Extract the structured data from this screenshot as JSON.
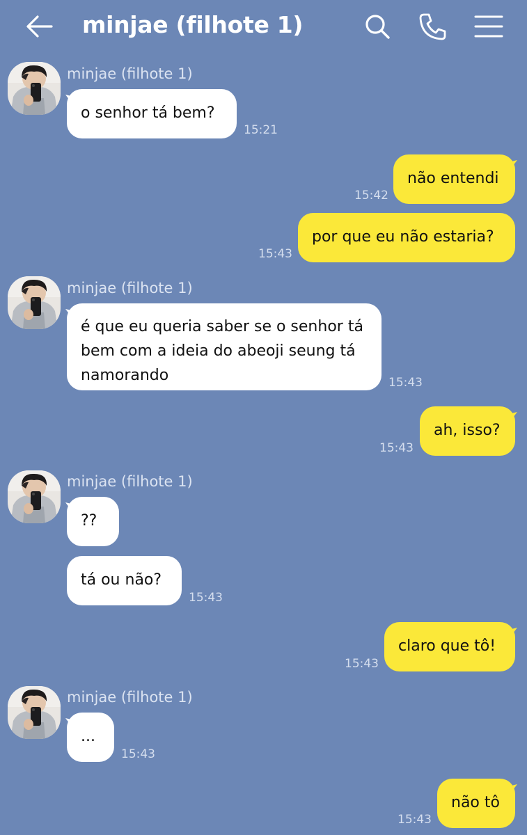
{
  "header": {
    "title": "minjae (filhote 1)",
    "back_icon": "arrow-left-icon",
    "search_icon": "search-icon",
    "call_icon": "phone-icon",
    "menu_icon": "hamburger-menu-icon"
  },
  "colors": {
    "background": "#6c87b6",
    "incoming_bubble": "#ffffff",
    "outgoing_bubble": "#fbe839"
  },
  "messages": [
    {
      "direction": "in",
      "sender": "minjae (filhote 1)",
      "text": "o senhor tá bem?",
      "time": "15:21"
    },
    {
      "direction": "out",
      "text": "não entendi",
      "time": "15:42"
    },
    {
      "direction": "out",
      "text": "por que eu não estaria?",
      "time": "15:43"
    },
    {
      "direction": "in",
      "sender": "minjae (filhote 1)",
      "text": "é que eu queria saber se o senhor tá bem com a ideia do abeoji seung tá namorando",
      "time": "15:43"
    },
    {
      "direction": "out",
      "text": "ah, isso?",
      "time": "15:43"
    },
    {
      "direction": "in",
      "sender": "minjae (filhote 1)",
      "text": "??",
      "time": ""
    },
    {
      "direction": "in",
      "text": "tá ou não?",
      "time": "15:43"
    },
    {
      "direction": "out",
      "text": "claro que tô!",
      "time": "15:43"
    },
    {
      "direction": "in",
      "sender": "minjae (filhote 1)",
      "text": "...",
      "time": "15:43"
    },
    {
      "direction": "out",
      "text": "não tô",
      "time": "15:43"
    }
  ]
}
